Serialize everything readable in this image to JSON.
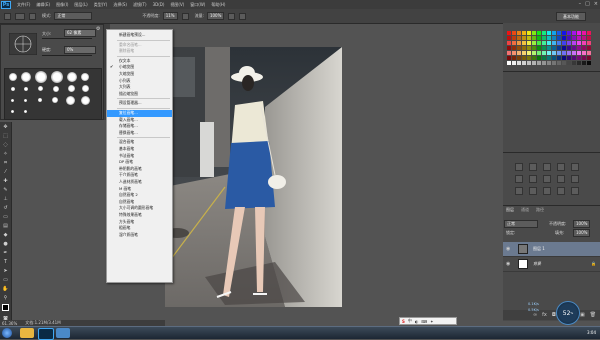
{
  "app": {
    "logo": "Ps"
  },
  "menubar": {
    "items": [
      "文件(F)",
      "编辑(E)",
      "图像(I)",
      "图层(L)",
      "类型(Y)",
      "选择(S)",
      "滤镜(T)",
      "3D(D)",
      "视图(V)",
      "窗口(W)",
      "帮助(H)"
    ],
    "window_controls": [
      "–",
      "□",
      "×"
    ]
  },
  "options": {
    "mode_label": "模式:",
    "mode_value": "正常",
    "opacity_label": "不透明度:",
    "opacity_value": "11%",
    "flow_label": "流量:",
    "flow_value": "100%",
    "workspace": "基本功能"
  },
  "brush_panel": {
    "size_label": "大小:",
    "size_value": "62 像素",
    "hardness_label": "硬度:",
    "hardness_value": "0%"
  },
  "context_menu": {
    "items": [
      {
        "label": "新建画笔预设...",
        "state": "normal"
      },
      {
        "sep": true
      },
      {
        "label": "重命名画笔...",
        "state": "disabled"
      },
      {
        "label": "删除画笔",
        "state": "disabled"
      },
      {
        "sep": true
      },
      {
        "label": "仅文本",
        "state": "normal"
      },
      {
        "label": "小缩览图",
        "state": "checked"
      },
      {
        "label": "大缩览图",
        "state": "normal"
      },
      {
        "label": "小列表",
        "state": "normal"
      },
      {
        "label": "大列表",
        "state": "normal"
      },
      {
        "label": "描边缩览图",
        "state": "normal"
      },
      {
        "sep": true
      },
      {
        "label": "预设管理器...",
        "state": "normal"
      },
      {
        "sep": true
      },
      {
        "label": "复位画笔...",
        "state": "highlight"
      },
      {
        "label": "载入画笔...",
        "state": "normal"
      },
      {
        "label": "存储画笔...",
        "state": "normal"
      },
      {
        "label": "替换画笔...",
        "state": "normal"
      },
      {
        "sep": true
      },
      {
        "label": "混合画笔",
        "state": "normal"
      },
      {
        "label": "基本画笔",
        "state": "normal"
      },
      {
        "label": "书法画笔",
        "state": "normal"
      },
      {
        "label": "DP 画笔",
        "state": "normal"
      },
      {
        "label": "带阴影的画笔",
        "state": "normal"
      },
      {
        "label": "干介质画笔",
        "state": "normal"
      },
      {
        "label": "人造材质画笔",
        "state": "normal"
      },
      {
        "label": "M 画笔",
        "state": "normal"
      },
      {
        "label": "自然画笔 2",
        "state": "normal"
      },
      {
        "label": "自然画笔",
        "state": "normal"
      },
      {
        "label": "大小可调的圆形画笔",
        "state": "normal"
      },
      {
        "label": "特殊效果画笔",
        "state": "normal"
      },
      {
        "label": "方头画笔",
        "state": "normal"
      },
      {
        "label": "粗画笔",
        "state": "normal"
      },
      {
        "label": "湿介质画笔",
        "state": "normal"
      }
    ]
  },
  "layers": {
    "tabs": [
      "图层",
      "通道",
      "路径"
    ],
    "blend_mode": "正常",
    "opacity_label": "不透明度:",
    "opacity_value": "100%",
    "lock_label": "锁定:",
    "fill_label": "填充:",
    "fill_value": "100%",
    "rows": [
      {
        "name": "图层 1"
      },
      {
        "name": "背景"
      }
    ]
  },
  "status": {
    "zoom": "61.36%",
    "doc": "文档:1.21M/3.41M"
  },
  "gauge": {
    "value": "52",
    "unit": "%"
  },
  "netinfo": {
    "up": "0.1K/s",
    "down": "0.5K/s"
  },
  "taskbar": {
    "time": "3:04"
  },
  "colors": {
    "accent": "#3399ff",
    "ps_blue": "#3fa8f4"
  }
}
